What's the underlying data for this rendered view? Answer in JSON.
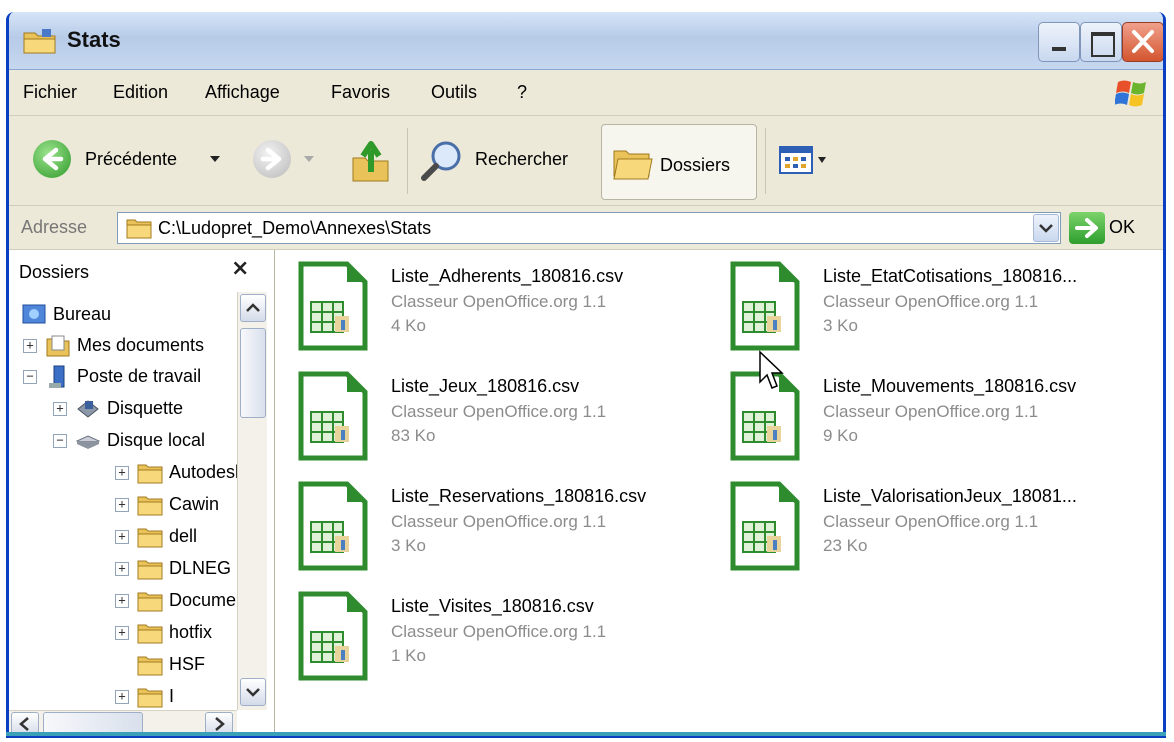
{
  "window": {
    "title": "Stats",
    "controls": [
      "minimize",
      "maximize",
      "close"
    ]
  },
  "menubar": {
    "items": [
      "Fichier",
      "Edition",
      "Affichage",
      "Favoris",
      "Outils",
      "?"
    ]
  },
  "toolbar": {
    "back_label": "Précédente",
    "search_label": "Rechercher",
    "folders_label": "Dossiers"
  },
  "address": {
    "label": "Adresse",
    "path": "C:\\Ludopret_Demo\\Annexes\\Stats",
    "go_label": "OK"
  },
  "folders_pane": {
    "title": "Dossiers",
    "close_glyph": "×",
    "tree": [
      {
        "label": "Bureau",
        "icon": "desktop-icon",
        "expander": ""
      },
      {
        "label": "Mes documents",
        "icon": "my-documents-icon",
        "expander": "+"
      },
      {
        "label": "Poste de travail",
        "icon": "my-computer-icon",
        "expander": "−"
      },
      {
        "label": "Disquette",
        "icon": "floppy-drive-icon",
        "expander": "+"
      },
      {
        "label": "Disque local",
        "icon": "hard-disk-icon",
        "expander": "−"
      },
      {
        "label": "Autodesk",
        "icon": "folder-icon",
        "expander": "+"
      },
      {
        "label": "Cawin",
        "icon": "folder-icon",
        "expander": "+"
      },
      {
        "label": "dell",
        "icon": "folder-icon",
        "expander": "+"
      },
      {
        "label": "DLNEG",
        "icon": "folder-icon",
        "expander": "+"
      },
      {
        "label": "Documents",
        "icon": "folder-icon",
        "expander": "+"
      },
      {
        "label": "hotfix",
        "icon": "folder-icon",
        "expander": "+"
      },
      {
        "label": "HSF",
        "icon": "folder-icon",
        "expander": ""
      },
      {
        "label": "I",
        "icon": "folder-icon",
        "expander": "+"
      }
    ]
  },
  "files": [
    {
      "name": "Liste_Adherents_180816.csv",
      "type": "Classeur OpenOffice.org 1.1",
      "size": "4 Ko"
    },
    {
      "name": "Liste_EtatCotisations_180816...",
      "type": "Classeur OpenOffice.org 1.1",
      "size": "3 Ko"
    },
    {
      "name": "Liste_Jeux_180816.csv",
      "type": "Classeur OpenOffice.org 1.1",
      "size": "83 Ko"
    },
    {
      "name": "Liste_Mouvements_180816.csv",
      "type": "Classeur OpenOffice.org 1.1",
      "size": "9 Ko"
    },
    {
      "name": "Liste_Reservations_180816.csv",
      "type": "Classeur OpenOffice.org 1.1",
      "size": "3 Ko"
    },
    {
      "name": "Liste_ValorisationJeux_18081...",
      "type": "Classeur OpenOffice.org 1.1",
      "size": "23 Ko"
    },
    {
      "name": "Liste_Visites_180816.csv",
      "type": "Classeur OpenOffice.org 1.1",
      "size": "1 Ko"
    }
  ],
  "colors": {
    "title_bar": "#c6d7ef",
    "file_icon_green": "#2e8b2e",
    "window_border": "#0a3fc4"
  }
}
